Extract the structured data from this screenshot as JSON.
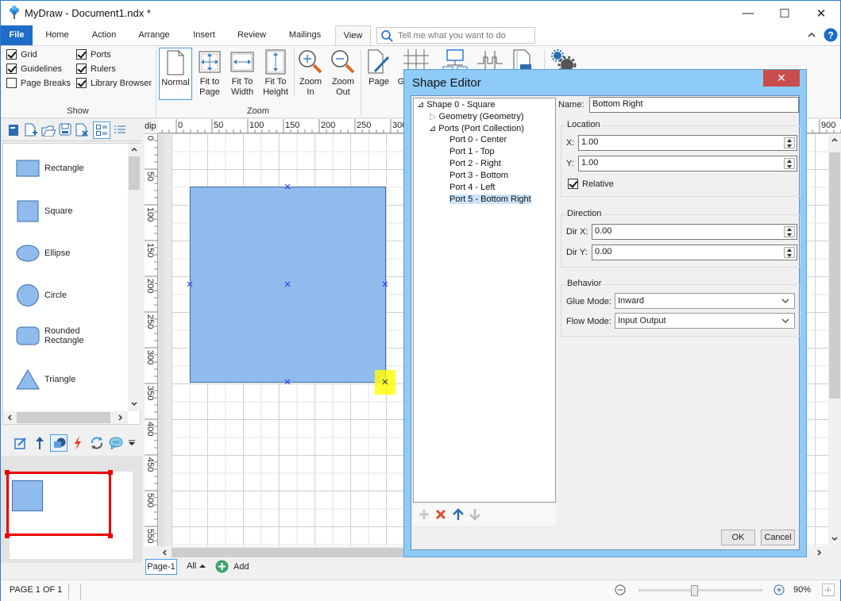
{
  "app": {
    "title": "MyDraw - Document1.ndx *",
    "window_controls": {
      "minimize": "—",
      "maximize": "☐",
      "close": "✕"
    }
  },
  "ribbon": {
    "tabs": [
      {
        "label": "File"
      },
      {
        "label": "Home"
      },
      {
        "label": "Action"
      },
      {
        "label": "Arrange"
      },
      {
        "label": "Insert"
      },
      {
        "label": "Review"
      },
      {
        "label": "Mailings"
      },
      {
        "label": "View",
        "active": true
      }
    ],
    "tell_me_placeholder": "Tell me what you want to do",
    "show_group": {
      "label": "Show",
      "checkboxes": [
        {
          "label": "Grid",
          "checked": true
        },
        {
          "label": "Guidelines",
          "checked": true
        },
        {
          "label": "Page Breaks",
          "checked": false
        },
        {
          "label": "Ports",
          "checked": true
        },
        {
          "label": "Rulers",
          "checked": true
        },
        {
          "label": "Library Browser",
          "checked": true
        }
      ]
    },
    "zoom_group": {
      "label": "Zoom",
      "buttons": [
        {
          "label_1": "Normal",
          "label_2": "",
          "selected": true
        },
        {
          "label_1": "Fit to",
          "label_2": "Page"
        },
        {
          "label_1": "Fit To",
          "label_2": "Width"
        },
        {
          "label_1": "Fit To",
          "label_2": "Height"
        },
        {
          "label_1": "Zoom",
          "label_2": "In"
        },
        {
          "label_1": "Zoom",
          "label_2": "Out"
        }
      ]
    },
    "other_buttons": [
      {
        "label": "Page"
      },
      {
        "label": "G"
      }
    ]
  },
  "library": {
    "shapes": [
      {
        "label": "Rectangle"
      },
      {
        "label": "Square"
      },
      {
        "label": "Ellipse"
      },
      {
        "label": "Circle"
      },
      {
        "label_1": "Rounded",
        "label_2": "Rectangle"
      },
      {
        "label": "Triangle"
      }
    ]
  },
  "rulers": {
    "unit": "dip",
    "top_ticks": [
      "0",
      "50",
      "100",
      "150",
      "200",
      "250",
      "300",
      "900"
    ],
    "left_ticks": [
      "0",
      "50",
      "100",
      "150",
      "200",
      "250",
      "300",
      "350",
      "400",
      "450",
      "500",
      "550"
    ]
  },
  "page_tabs": {
    "current": "Page-1",
    "all_label": "All",
    "add_label": "Add"
  },
  "status": {
    "page_info": "PAGE 1 OF 1",
    "zoom_percent": "90%",
    "zoom_slider_position": 0.45
  },
  "shape_editor": {
    "title": "Shape Editor",
    "close": "✕",
    "tree": [
      {
        "label": "Shape 0 - Square",
        "level": 0,
        "expander": "⊿"
      },
      {
        "label": "Geometry (Geometry)",
        "level": 1,
        "expander": "▷"
      },
      {
        "label": "Ports (Port Collection)",
        "level": 1,
        "expander": "⊿"
      },
      {
        "label": "Port 0 - Center",
        "level": 2
      },
      {
        "label": "Port 1 - Top",
        "level": 2
      },
      {
        "label": "Port 2 - Right",
        "level": 2
      },
      {
        "label": "Port 3 - Bottom",
        "level": 2
      },
      {
        "label": "Port 4 - Left",
        "level": 2
      },
      {
        "label": "Port 5 - Bottom Right",
        "level": 2,
        "selected": true
      }
    ],
    "name_label": "Name:",
    "name_value": "Bottom Right",
    "location": {
      "legend": "Location",
      "x_label": "X:",
      "x_value": "1.00",
      "y_label": "Y:",
      "y_value": "1.00",
      "relative_label": "Relative",
      "relative_checked": true
    },
    "direction": {
      "legend": "Direction",
      "dirx_label": "Dir X:",
      "dirx_value": "0.00",
      "diry_label": "Dir Y:",
      "diry_value": "0.00"
    },
    "behavior": {
      "legend": "Behavior",
      "glue_label": "Glue Mode:",
      "glue_value": "Inward",
      "flow_label": "Flow Mode:",
      "flow_value": "Input Output"
    },
    "ok_label": "OK",
    "cancel_label": "Cancel"
  },
  "colors": {
    "accent": "#1c6cc8",
    "shape_fill": "#8fbcec",
    "shape_stroke": "#3a6ea8",
    "port_highlight": "#ffff33",
    "dialog_frame": "#8ecbf7",
    "close_red": "#c94d4d",
    "preview_frame": "#ee0000"
  }
}
